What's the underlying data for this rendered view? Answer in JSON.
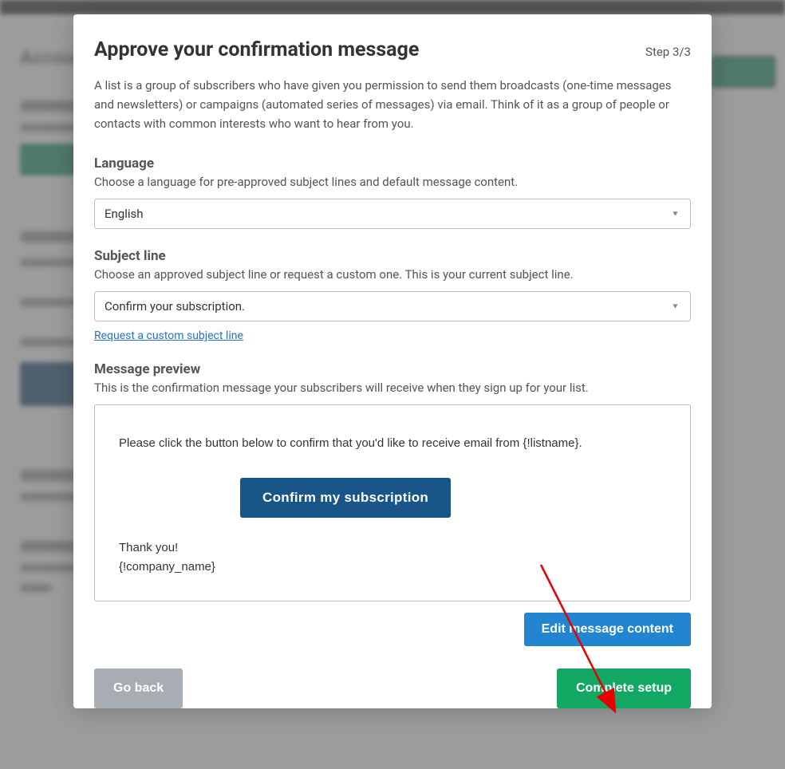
{
  "modal": {
    "title": "Approve your confirmation message",
    "step": "Step 3/3",
    "description": "A list is a group of subscribers who have given you permission to send them broadcasts (one-time messages and newsletters) or campaigns (automated series of messages) via email. Think of it as a group of people or contacts with common interests who want to hear from you."
  },
  "language": {
    "title": "Language",
    "help": "Choose a language for pre-approved subject lines and default message content.",
    "selected": "English"
  },
  "subject": {
    "title": "Subject line",
    "help": "Choose an approved subject line or request a custom one. This is your current subject line.",
    "selected": "Confirm your subscription.",
    "request_link": "Request a custom subject line"
  },
  "preview": {
    "title": "Message preview",
    "help": "This is the confirmation message your subscribers will receive when they sign up for your list.",
    "intro": "Please click the button below to confirm that you'd like to receive email from {!listname}.",
    "confirm_button": "Confirm my subscription",
    "thanks_line1": "Thank you!",
    "thanks_line2": "{!company_name}",
    "edit_button": "Edit message content"
  },
  "footer": {
    "goback": "Go back",
    "complete": "Complete setup"
  }
}
